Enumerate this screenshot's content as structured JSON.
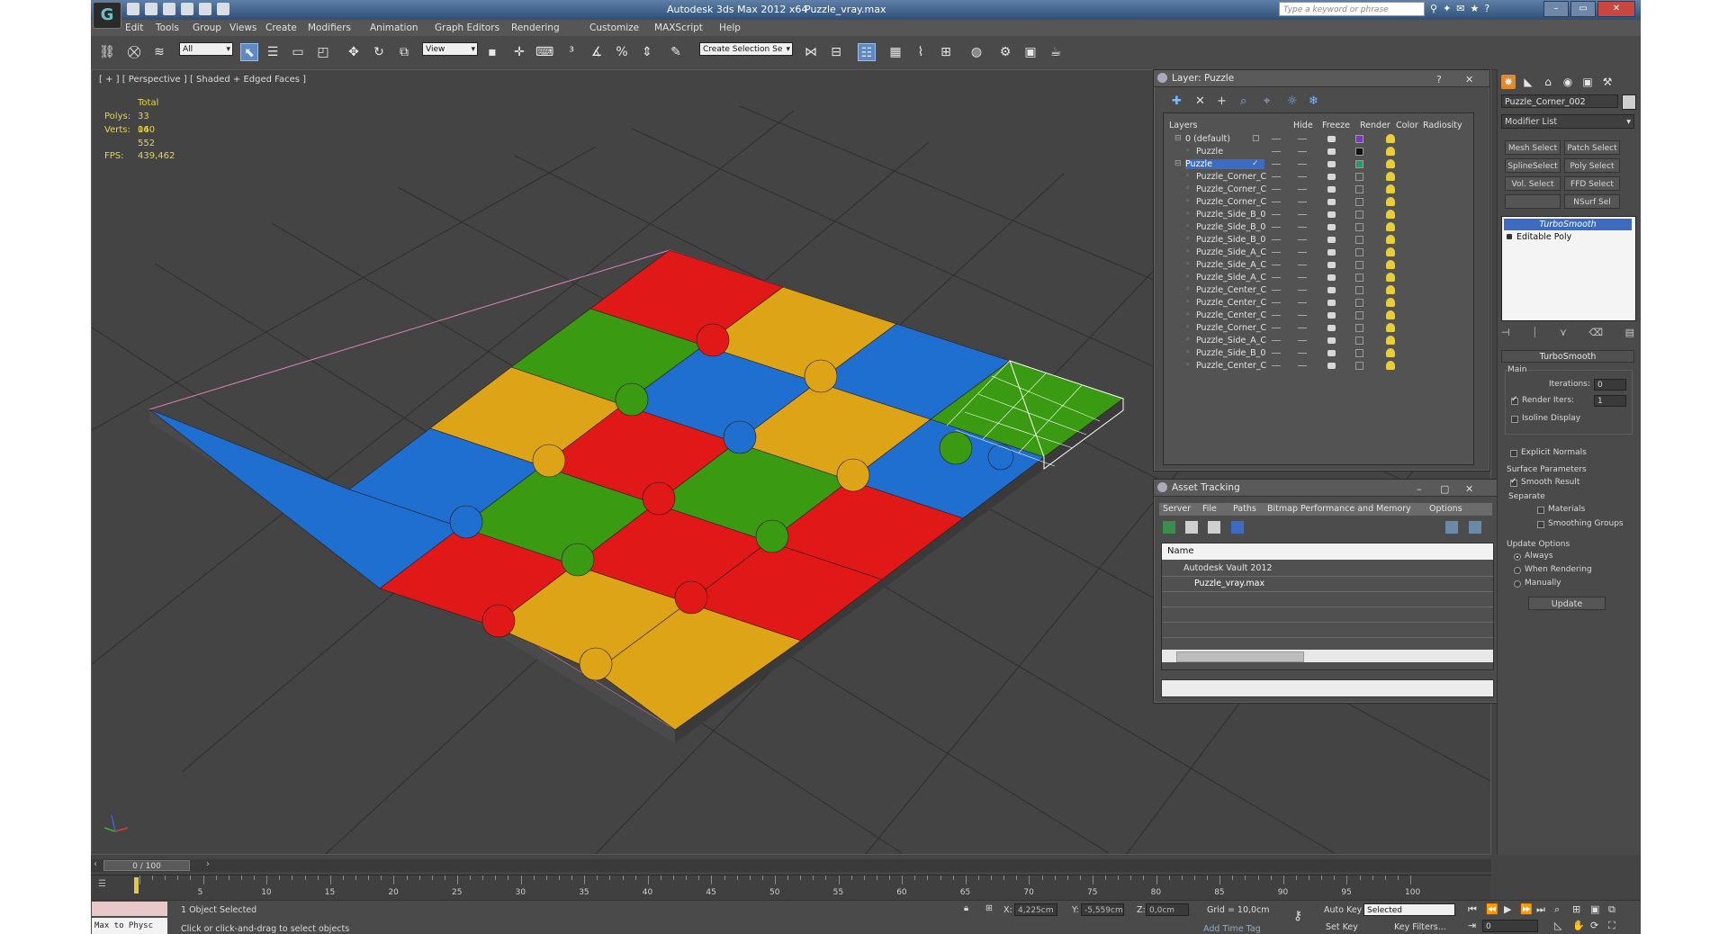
{
  "app": {
    "title": "Autodesk 3ds Max  2012 x64",
    "file": "Puzzle_vray.max",
    "logo": "G",
    "search_placeholder": "Type a keyword or phrase"
  },
  "menu": [
    "Edit",
    "Tools",
    "Group",
    "Views",
    "Create",
    "Modifiers",
    "Animation",
    "Graph Editors",
    "Rendering",
    "Customize",
    "MAXScript",
    "Help"
  ],
  "toolbar": {
    "selection_filter": "All",
    "reference_coord": "View",
    "named_selection": "Create Selection Se"
  },
  "viewport": {
    "label": "[ + ] [ Perspective ] [ Shaded + Edged Faces ]",
    "stats": {
      "total_label": "Total",
      "polys_label": "Polys:",
      "polys": "33 040",
      "verts_label": "Verts:",
      "verts": "16 552",
      "fps_label": "FPS:",
      "fps": "439,462"
    },
    "colors": {
      "red": "#e01818",
      "green": "#3a9a12",
      "blue": "#1f6fd0",
      "yellow": "#dea418",
      "background": "#444444"
    }
  },
  "layer_panel": {
    "title": "Layer: Puzzle",
    "columns": [
      "Layers",
      "Hide",
      "Freeze",
      "Render",
      "Color",
      "Radiosity"
    ],
    "rows": [
      {
        "name": "0 (default)",
        "indent": 0,
        "color": "#8a2be2",
        "selected": false
      },
      {
        "name": "Puzzle",
        "indent": 1,
        "color": "#111111",
        "selected": false
      },
      {
        "name": "Puzzle",
        "indent": 0,
        "color": "#1aa06a",
        "selected": true
      },
      {
        "name": "Puzzle_Corner_C",
        "indent": 1,
        "color": "",
        "selected": false
      },
      {
        "name": "Puzzle_Corner_C",
        "indent": 1,
        "color": "",
        "selected": false
      },
      {
        "name": "Puzzle_Corner_C",
        "indent": 1,
        "color": "",
        "selected": false
      },
      {
        "name": "Puzzle_Side_B_0",
        "indent": 1,
        "color": "",
        "selected": false
      },
      {
        "name": "Puzzle_Side_B_0",
        "indent": 1,
        "color": "",
        "selected": false
      },
      {
        "name": "Puzzle_Side_B_0",
        "indent": 1,
        "color": "",
        "selected": false
      },
      {
        "name": "Puzzle_Side_A_C",
        "indent": 1,
        "color": "",
        "selected": false
      },
      {
        "name": "Puzzle_Side_A_C",
        "indent": 1,
        "color": "",
        "selected": false
      },
      {
        "name": "Puzzle_Side_A_C",
        "indent": 1,
        "color": "",
        "selected": false
      },
      {
        "name": "Puzzle_Center_C",
        "indent": 1,
        "color": "",
        "selected": false
      },
      {
        "name": "Puzzle_Center_C",
        "indent": 1,
        "color": "",
        "selected": false
      },
      {
        "name": "Puzzle_Center_C",
        "indent": 1,
        "color": "",
        "selected": false
      },
      {
        "name": "Puzzle_Corner_C",
        "indent": 1,
        "color": "",
        "selected": false
      },
      {
        "name": "Puzzle_Side_A_C",
        "indent": 1,
        "color": "",
        "selected": false
      },
      {
        "name": "Puzzle_Side_B_0",
        "indent": 1,
        "color": "",
        "selected": false
      },
      {
        "name": "Puzzle_Center_C",
        "indent": 1,
        "color": "",
        "selected": false
      }
    ]
  },
  "asset_tracking": {
    "title": "Asset Tracking",
    "menu": [
      "Server",
      "File",
      "Paths",
      "Bitmap Performance and Memory",
      "Options"
    ],
    "column": "Name",
    "rows": [
      "Autodesk Vault 2012",
      "Puzzle_vray.max"
    ]
  },
  "command_panel": {
    "object_name": "Puzzle_Corner_002",
    "modifier_list": "Modifier List",
    "buttons": [
      "Mesh Select",
      "Patch Select",
      "SplineSelect",
      "Poly Select",
      "Vol. Select",
      "FFD Select",
      "",
      "NSurf Sel"
    ],
    "stack": [
      "TurboSmooth",
      "Editable Poly"
    ],
    "rollout": "TurboSmooth",
    "main_label": "Main",
    "iterations_label": "Iterations:",
    "iterations": "0",
    "render_iters_label": "Render Iters:",
    "render_iters": "1",
    "isoline_label": "Isoline Display",
    "explicit_label": "Explicit Normals",
    "surface_label": "Surface Parameters",
    "smooth_label": "Smooth Result",
    "separate_label": "Separate",
    "materials_label": "Materials",
    "smoothing_label": "Smoothing Groups",
    "update_label": "Update Options",
    "always_label": "Always",
    "when_rendering_label": "When Rendering",
    "manually_label": "Manually",
    "update_button": "Update"
  },
  "timeline": {
    "slider": "0 / 100",
    "ticks": [
      "5",
      "10",
      "15",
      "20",
      "25",
      "30",
      "35",
      "40",
      "45",
      "50",
      "55",
      "60",
      "65",
      "70",
      "75",
      "80",
      "85",
      "90",
      "95",
      "100"
    ]
  },
  "status": {
    "maxscript_top": "",
    "maxscript_bottom": "Max to Physc",
    "selected": "1 Object Selected",
    "prompt": "Click or click-and-drag to select objects",
    "x_label": "X:",
    "x": "4,225cm",
    "y_label": "Y:",
    "y": "-5,559cm",
    "z_label": "Z:",
    "z": "0,0cm",
    "grid": "Grid = 10,0cm",
    "auto_key": "Auto Key",
    "auto_key_mode": "Selected",
    "set_key": "Set Key",
    "key_filters": "Key Filters...",
    "add_time_tag": "Add Time Tag",
    "frame": "0"
  }
}
